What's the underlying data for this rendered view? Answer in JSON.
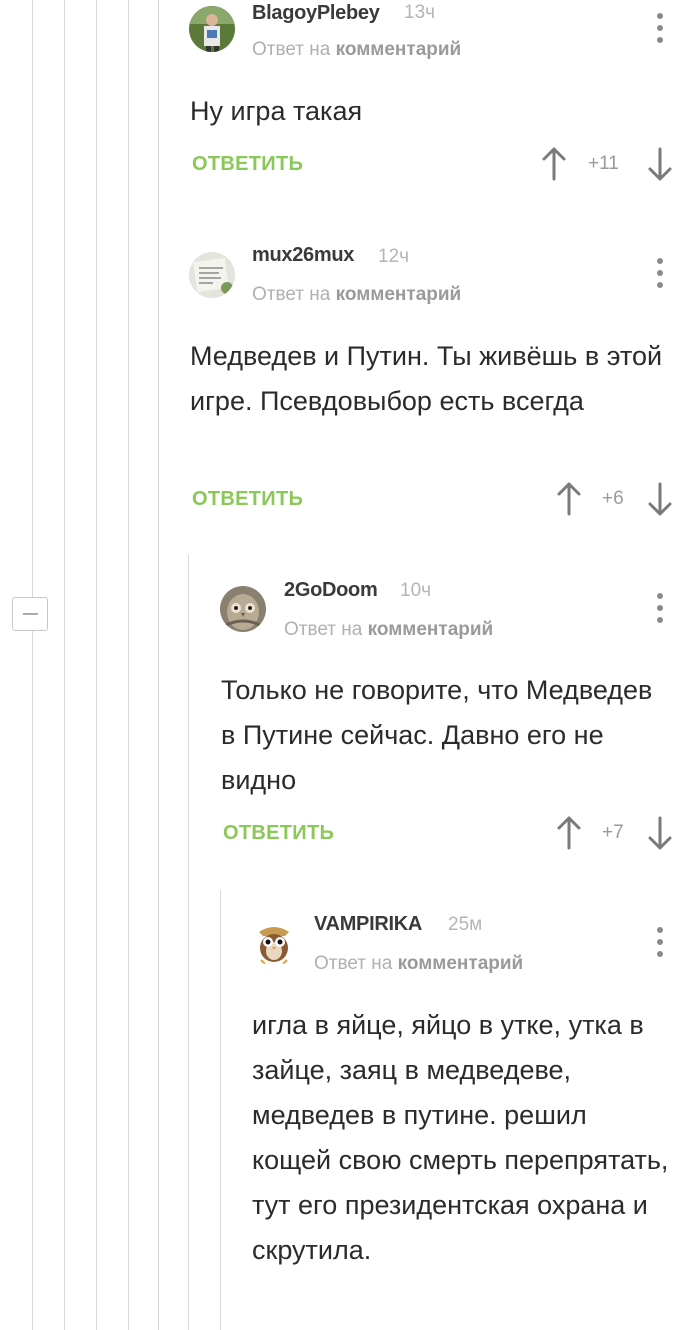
{
  "comments": [
    {
      "username": "BlagoyPlebey",
      "time": "13ч",
      "reply_prefix": "Ответ на",
      "reply_link": "комментарий",
      "text": "Ну игра такая",
      "reply_label": "ОТВЕТИТЬ",
      "rating": "+11",
      "avatar_icon": "user-photo-avatar"
    },
    {
      "username": "mux26mux",
      "time": "12ч",
      "reply_prefix": "Ответ на",
      "reply_link": "комментарий",
      "text": "Медведев и Путин. Ты живёшь в этой игре. Псевдовыбор есть всегда",
      "reply_label": "ОТВЕТИТЬ",
      "rating": "+6",
      "avatar_icon": "handwritten-note-avatar"
    },
    {
      "username": "2GoDoom",
      "time": "10ч",
      "reply_prefix": "Ответ на",
      "reply_link": "комментарий",
      "text": "Только не говорите, что Медведев в Путине сейчас. Давно его не видно",
      "reply_label": "ОТВЕТИТЬ",
      "rating": "+7",
      "avatar_icon": "owl-photo-avatar"
    },
    {
      "username": "VAMPIRIKA",
      "time": "25м",
      "reply_prefix": "Ответ на",
      "reply_link": "комментарий",
      "text": "игла в яйце, яйцо в утке, утка в зайце, заяц в медведеве, медведев в путине. решил кощей свою смерть перепрятать, тут его президентская охрана и скрутила.",
      "avatar_icon": "cartoon-owl-avatar"
    }
  ],
  "icons": {
    "menu": "more-vertical-icon",
    "upvote": "arrow-up-icon",
    "downvote": "arrow-down-icon",
    "collapse": "minus-icon"
  },
  "colors": {
    "reply_green": "#8ac858",
    "thread_line": "#d8d8d8",
    "username": "#3a3a3a",
    "muted": "#b0b0b0"
  }
}
